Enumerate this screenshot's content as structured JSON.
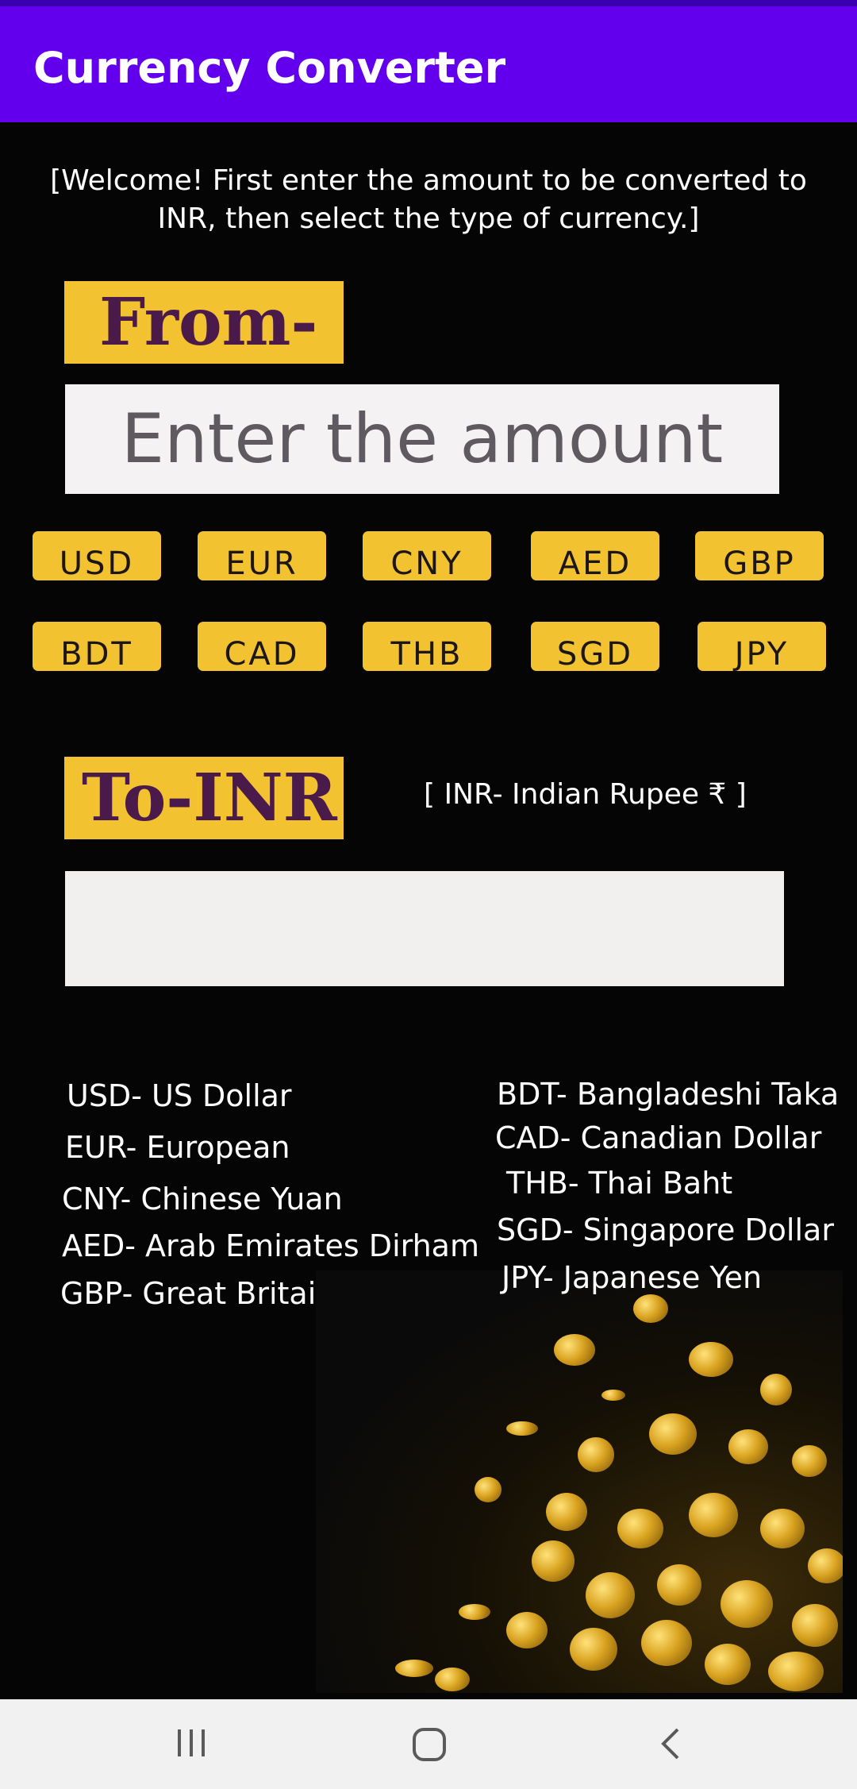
{
  "appbar": {
    "title": "Currency Converter"
  },
  "welcome": "[Welcome! First enter the amount to be converted to INR, then select the type of currency.]",
  "from": {
    "label": "From-",
    "placeholder": "Enter the amount"
  },
  "currency_buttons": [
    "USD",
    "EUR",
    "CNY",
    "AED",
    "GBP",
    "BDT",
    "CAD",
    "THB",
    "SGD",
    "JPY"
  ],
  "to": {
    "label": "To-INR",
    "note": "[ INR- Indian Rupee ₹ ]",
    "result": ""
  },
  "legend_left": [
    "USD- US Dollar",
    "EUR- European",
    "CNY- Chinese Yuan",
    "AED- Arab Emirates Dirham",
    "GBP- Great Britain Pound"
  ],
  "legend_right": [
    "BDT- Bangladeshi Taka",
    "CAD- Canadian Dollar",
    "THB- Thai Baht",
    "SGD- Singapore Dollar",
    "JPY- Japanese Yen"
  ],
  "navbar": {
    "icons": [
      "recent-apps-icon",
      "home-icon",
      "back-icon"
    ]
  },
  "colors": {
    "appbar": "#6200ee",
    "accent": "#f2c230",
    "label_text": "#4a1a4a",
    "background": "#050505"
  }
}
